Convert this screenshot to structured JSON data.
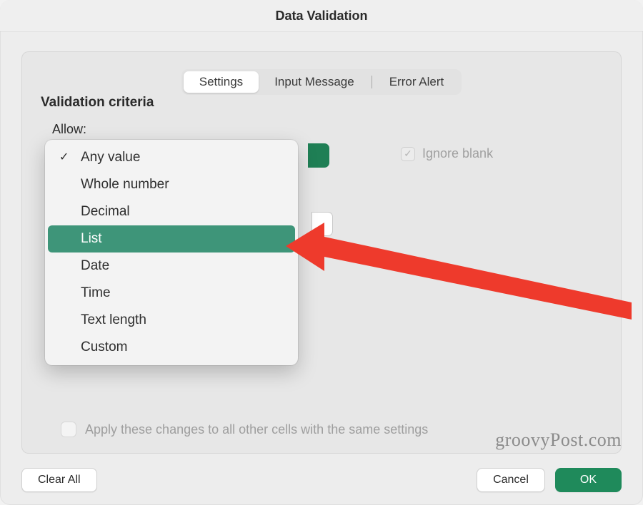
{
  "title": "Data Validation",
  "tabs": {
    "settings": "Settings",
    "input_message": "Input Message",
    "error_alert": "Error Alert"
  },
  "section": {
    "title": "Validation criteria",
    "allow_label": "Allow:"
  },
  "allow_options": {
    "o0": "Any value",
    "o1": "Whole number",
    "o2": "Decimal",
    "o3": "List",
    "o4": "Date",
    "o5": "Time",
    "o6": "Text length",
    "o7": "Custom",
    "selected_index": 0,
    "highlight_index": 3
  },
  "ignore_blank": {
    "label": "Ignore blank",
    "checked": true,
    "disabled": true
  },
  "apply_all": {
    "label": "Apply these changes to all other cells with the same settings",
    "checked": false,
    "disabled": true
  },
  "buttons": {
    "clear_all": "Clear All",
    "cancel": "Cancel",
    "ok": "OK"
  },
  "watermark": "groovyPost.com",
  "colors": {
    "accent": "#1f8a5b",
    "dropdown_highlight": "#3e9579",
    "arrow": "#ee3a2c"
  }
}
